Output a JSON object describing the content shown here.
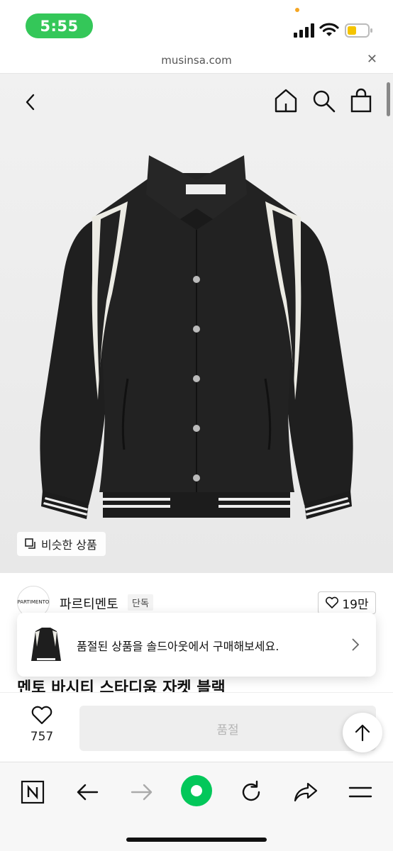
{
  "status_bar": {
    "time": "5:55"
  },
  "browser": {
    "url": "musinsa.com",
    "close_glyph": "✕"
  },
  "product": {
    "similar_button_label": "비슷한 상품",
    "brand_logo_text": "PARTIMENTO",
    "brand_name": "파르티멘토",
    "exclusive_badge": "단독",
    "like_count": "19만",
    "title_partial": "멘토 바시티 스타디움 자켓 블랙"
  },
  "soldout_toast": {
    "message": "품절된 상품을 솔드아웃에서 구매해보세요."
  },
  "purchase_bar": {
    "wish_count": "757",
    "soldout_label": "품절"
  },
  "icons": {
    "header": [
      "back-icon",
      "home-icon",
      "search-icon",
      "shopping-bag-icon"
    ],
    "browser_nav": [
      "naver-n-icon",
      "back-arrow-icon",
      "forward-arrow-icon",
      "green-home-dot-icon",
      "refresh-icon",
      "share-icon",
      "menu-icon"
    ]
  },
  "colors": {
    "status_pill": "#34c759",
    "naver_green": "#03c75a",
    "soldout_text": "#b5b5b5"
  }
}
